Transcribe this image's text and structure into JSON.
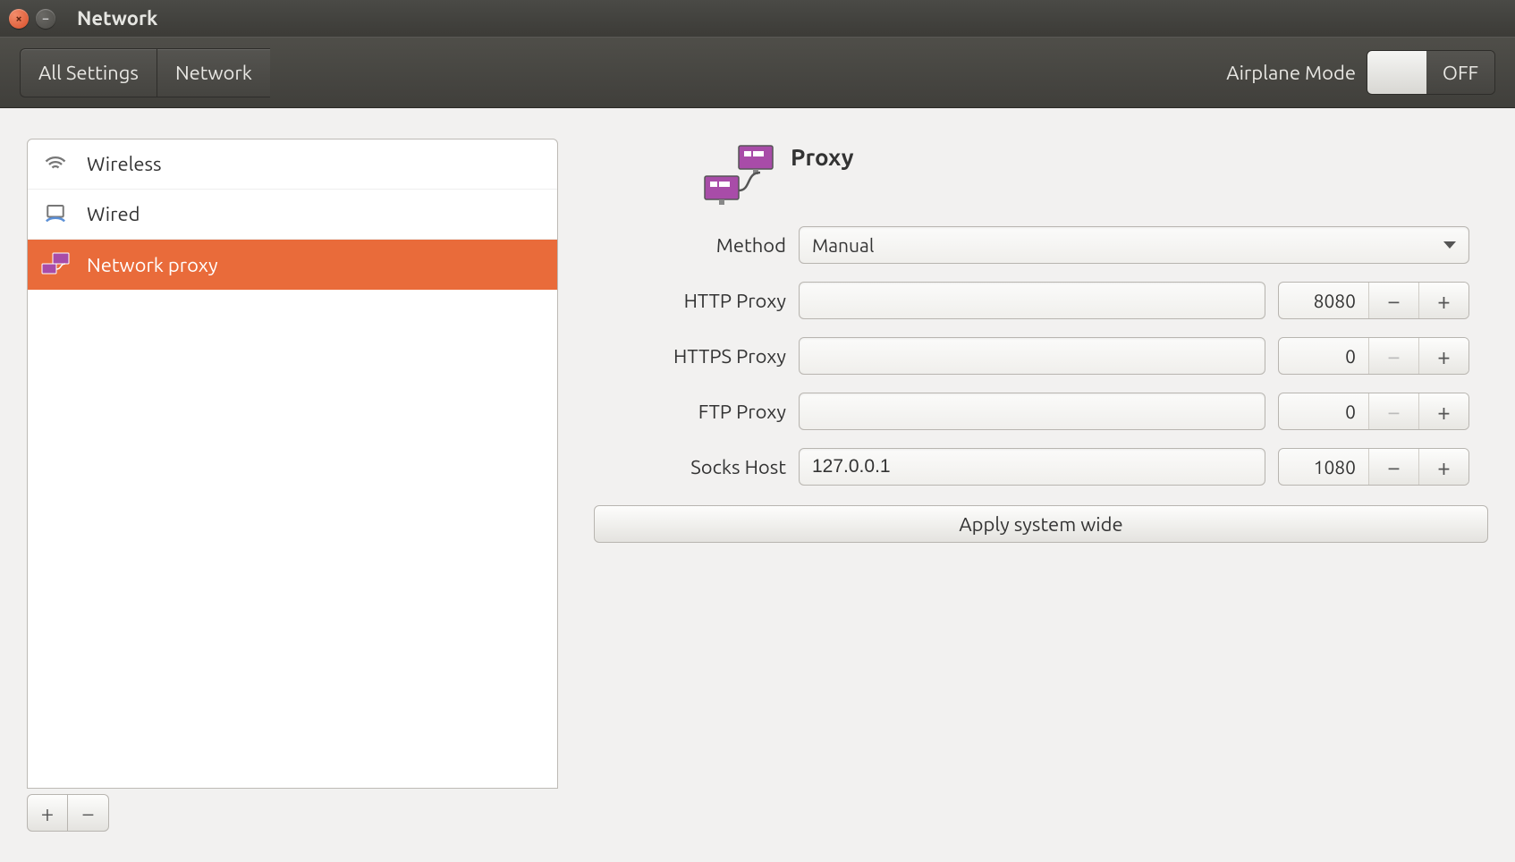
{
  "window": {
    "title": "Network"
  },
  "toolbar": {
    "all_settings": "All Settings",
    "network": "Network",
    "airplane_label": "Airplane Mode",
    "airplane_state": "OFF"
  },
  "sidebar": {
    "items": [
      {
        "label": "Wireless"
      },
      {
        "label": "Wired"
      },
      {
        "label": "Network proxy"
      }
    ]
  },
  "main": {
    "title": "Proxy",
    "method_label": "Method",
    "method_value": "Manual",
    "rows": [
      {
        "label": "HTTP Proxy",
        "host": "",
        "port": "8080",
        "minus_disabled": false
      },
      {
        "label": "HTTPS Proxy",
        "host": "",
        "port": "0",
        "minus_disabled": true
      },
      {
        "label": "FTP Proxy",
        "host": "",
        "port": "0",
        "minus_disabled": true
      },
      {
        "label": "Socks Host",
        "host": "127.0.0.1",
        "port": "1080",
        "minus_disabled": false
      }
    ],
    "apply": "Apply system wide"
  }
}
